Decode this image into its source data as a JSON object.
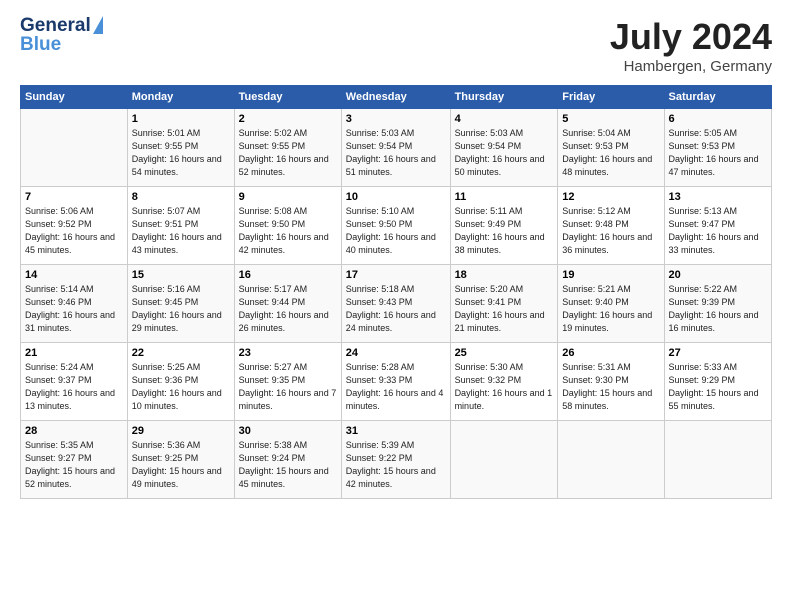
{
  "header": {
    "logo_line1": "General",
    "logo_line2": "Blue",
    "month_title": "July 2024",
    "subtitle": "Hambergen, Germany"
  },
  "calendar": {
    "days_of_week": [
      "Sunday",
      "Monday",
      "Tuesday",
      "Wednesday",
      "Thursday",
      "Friday",
      "Saturday"
    ],
    "weeks": [
      [
        {
          "day": "",
          "info": ""
        },
        {
          "day": "1",
          "info": "Sunrise: 5:01 AM\nSunset: 9:55 PM\nDaylight: 16 hours\nand 54 minutes."
        },
        {
          "day": "2",
          "info": "Sunrise: 5:02 AM\nSunset: 9:55 PM\nDaylight: 16 hours\nand 52 minutes."
        },
        {
          "day": "3",
          "info": "Sunrise: 5:03 AM\nSunset: 9:54 PM\nDaylight: 16 hours\nand 51 minutes."
        },
        {
          "day": "4",
          "info": "Sunrise: 5:03 AM\nSunset: 9:54 PM\nDaylight: 16 hours\nand 50 minutes."
        },
        {
          "day": "5",
          "info": "Sunrise: 5:04 AM\nSunset: 9:53 PM\nDaylight: 16 hours\nand 48 minutes."
        },
        {
          "day": "6",
          "info": "Sunrise: 5:05 AM\nSunset: 9:53 PM\nDaylight: 16 hours\nand 47 minutes."
        }
      ],
      [
        {
          "day": "7",
          "info": "Sunrise: 5:06 AM\nSunset: 9:52 PM\nDaylight: 16 hours\nand 45 minutes."
        },
        {
          "day": "8",
          "info": "Sunrise: 5:07 AM\nSunset: 9:51 PM\nDaylight: 16 hours\nand 43 minutes."
        },
        {
          "day": "9",
          "info": "Sunrise: 5:08 AM\nSunset: 9:50 PM\nDaylight: 16 hours\nand 42 minutes."
        },
        {
          "day": "10",
          "info": "Sunrise: 5:10 AM\nSunset: 9:50 PM\nDaylight: 16 hours\nand 40 minutes."
        },
        {
          "day": "11",
          "info": "Sunrise: 5:11 AM\nSunset: 9:49 PM\nDaylight: 16 hours\nand 38 minutes."
        },
        {
          "day": "12",
          "info": "Sunrise: 5:12 AM\nSunset: 9:48 PM\nDaylight: 16 hours\nand 36 minutes."
        },
        {
          "day": "13",
          "info": "Sunrise: 5:13 AM\nSunset: 9:47 PM\nDaylight: 16 hours\nand 33 minutes."
        }
      ],
      [
        {
          "day": "14",
          "info": "Sunrise: 5:14 AM\nSunset: 9:46 PM\nDaylight: 16 hours\nand 31 minutes."
        },
        {
          "day": "15",
          "info": "Sunrise: 5:16 AM\nSunset: 9:45 PM\nDaylight: 16 hours\nand 29 minutes."
        },
        {
          "day": "16",
          "info": "Sunrise: 5:17 AM\nSunset: 9:44 PM\nDaylight: 16 hours\nand 26 minutes."
        },
        {
          "day": "17",
          "info": "Sunrise: 5:18 AM\nSunset: 9:43 PM\nDaylight: 16 hours\nand 24 minutes."
        },
        {
          "day": "18",
          "info": "Sunrise: 5:20 AM\nSunset: 9:41 PM\nDaylight: 16 hours\nand 21 minutes."
        },
        {
          "day": "19",
          "info": "Sunrise: 5:21 AM\nSunset: 9:40 PM\nDaylight: 16 hours\nand 19 minutes."
        },
        {
          "day": "20",
          "info": "Sunrise: 5:22 AM\nSunset: 9:39 PM\nDaylight: 16 hours\nand 16 minutes."
        }
      ],
      [
        {
          "day": "21",
          "info": "Sunrise: 5:24 AM\nSunset: 9:37 PM\nDaylight: 16 hours\nand 13 minutes."
        },
        {
          "day": "22",
          "info": "Sunrise: 5:25 AM\nSunset: 9:36 PM\nDaylight: 16 hours\nand 10 minutes."
        },
        {
          "day": "23",
          "info": "Sunrise: 5:27 AM\nSunset: 9:35 PM\nDaylight: 16 hours\nand 7 minutes."
        },
        {
          "day": "24",
          "info": "Sunrise: 5:28 AM\nSunset: 9:33 PM\nDaylight: 16 hours\nand 4 minutes."
        },
        {
          "day": "25",
          "info": "Sunrise: 5:30 AM\nSunset: 9:32 PM\nDaylight: 16 hours\nand 1 minute."
        },
        {
          "day": "26",
          "info": "Sunrise: 5:31 AM\nSunset: 9:30 PM\nDaylight: 15 hours\nand 58 minutes."
        },
        {
          "day": "27",
          "info": "Sunrise: 5:33 AM\nSunset: 9:29 PM\nDaylight: 15 hours\nand 55 minutes."
        }
      ],
      [
        {
          "day": "28",
          "info": "Sunrise: 5:35 AM\nSunset: 9:27 PM\nDaylight: 15 hours\nand 52 minutes."
        },
        {
          "day": "29",
          "info": "Sunrise: 5:36 AM\nSunset: 9:25 PM\nDaylight: 15 hours\nand 49 minutes."
        },
        {
          "day": "30",
          "info": "Sunrise: 5:38 AM\nSunset: 9:24 PM\nDaylight: 15 hours\nand 45 minutes."
        },
        {
          "day": "31",
          "info": "Sunrise: 5:39 AM\nSunset: 9:22 PM\nDaylight: 15 hours\nand 42 minutes."
        },
        {
          "day": "",
          "info": ""
        },
        {
          "day": "",
          "info": ""
        },
        {
          "day": "",
          "info": ""
        }
      ]
    ]
  }
}
